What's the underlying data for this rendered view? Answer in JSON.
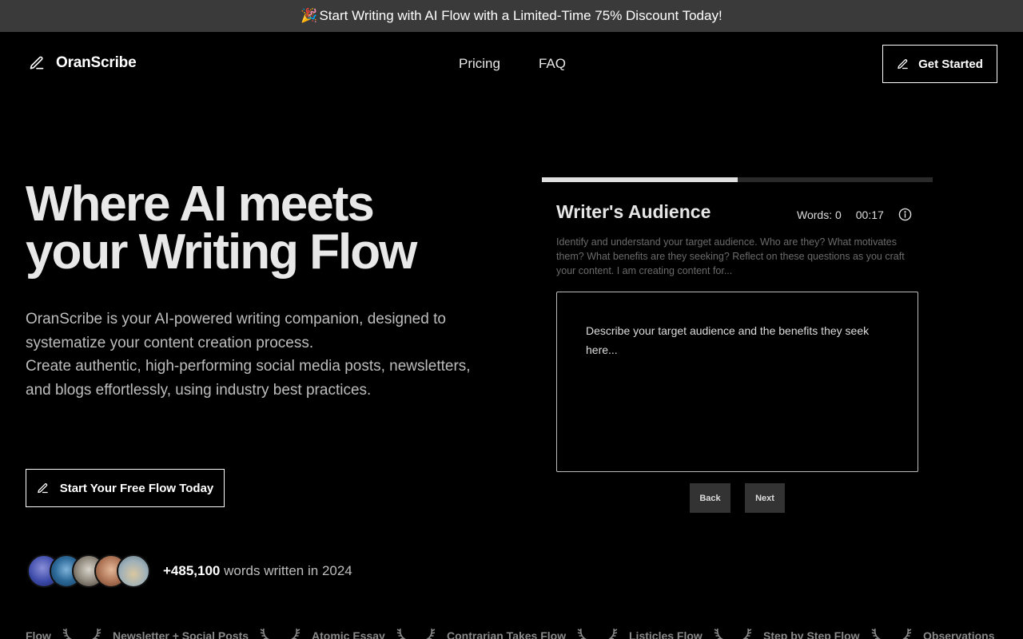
{
  "promo": {
    "emoji": "🎉",
    "text": "Start Writing with AI Flow with a Limited-Time 75% Discount Today!"
  },
  "nav": {
    "brand": "OranScribe",
    "links": [
      "Pricing",
      "FAQ"
    ],
    "cta": "Get Started"
  },
  "hero": {
    "title_line1": "Where AI meets",
    "title_line2": "your Writing Flow",
    "desc1": "OranScribe is your AI-powered writing companion, designed to systematize your content creation process.",
    "desc2": "Create authentic, high-performing social media posts, newsletters, and blogs effortlessly, using industry best practices.",
    "cta": "Start Your Free Flow Today"
  },
  "proof": {
    "count": "+485,100",
    "suffix": "words written in 2024"
  },
  "panel": {
    "progress": 0.5,
    "title": "Writer's Audience",
    "words": "Words: 0",
    "timer": "00:17",
    "description": "Identify and understand your target audience. Who are they? What motivates them? What benefits are they seeking? Reflect on these questions as you craft your content. I am creating content for...",
    "placeholder": "Describe your target audience and the benefits they seek here...",
    "back": "Back",
    "next": "Next"
  },
  "ticker": [
    "Flow",
    "Newsletter + Social Posts",
    "Atomic Essay",
    "Contrarian Takes Flow",
    "Listicles Flow",
    "Step by Step Flow",
    "Observations"
  ],
  "colors": {
    "bg": "#000000",
    "promo_bg": "#3a3a3a",
    "progress_fill": "#e0e0e0",
    "button_bg": "#333333"
  }
}
